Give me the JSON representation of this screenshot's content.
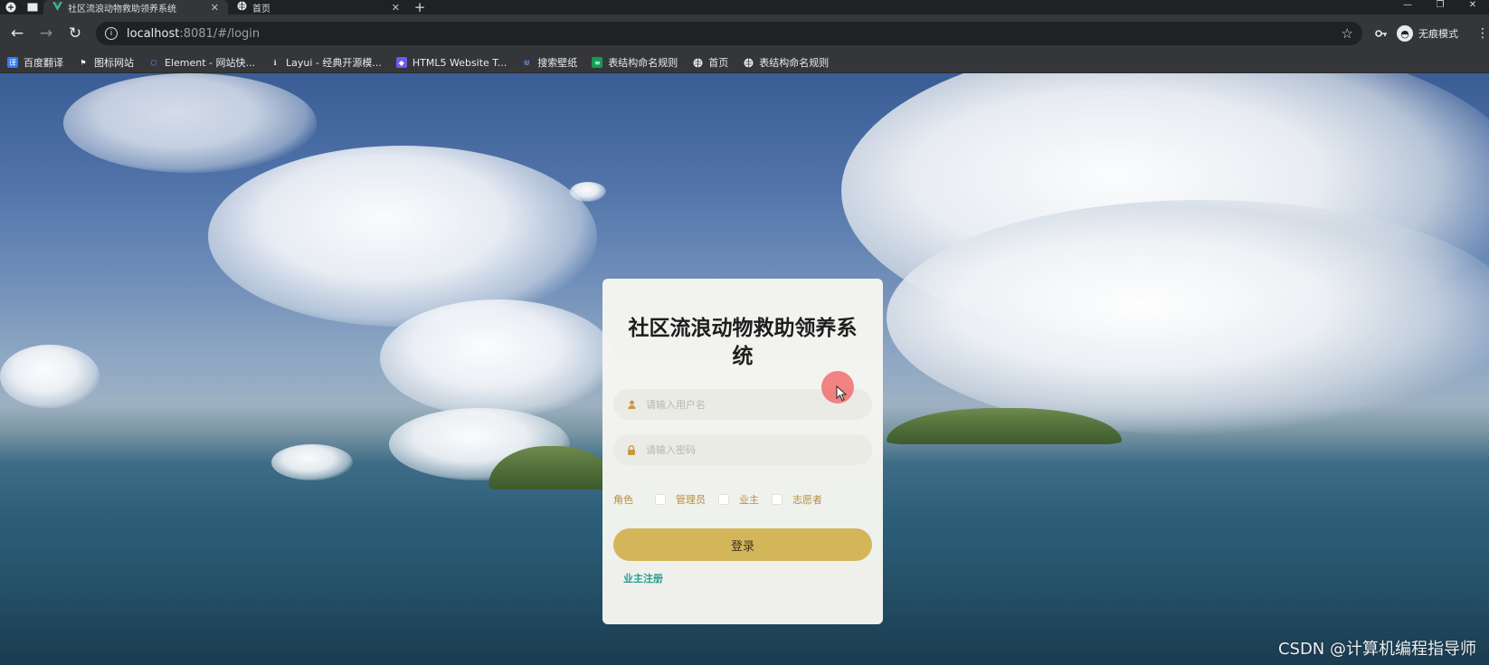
{
  "browser": {
    "tabs": [
      {
        "title": "社区流浪动物救助领养系统",
        "active": true
      },
      {
        "title": "首页",
        "active": false
      }
    ],
    "url_host": "localhost",
    "url_rest": ":8081/#/login",
    "incognito_label": "无痕模式",
    "bookmarks": [
      {
        "label": "百度翻译",
        "icon": "translate-icon"
      },
      {
        "label": "图标网站",
        "icon": "flag-icon"
      },
      {
        "label": "Element - 网站快...",
        "icon": "element-icon"
      },
      {
        "label": "Layui - 经典开源模...",
        "icon": "layui-icon"
      },
      {
        "label": "HTML5 Website T...",
        "icon": "html5-icon"
      },
      {
        "label": "搜索壁纸",
        "icon": "wallpaper-icon"
      },
      {
        "label": "表结构命名规则",
        "icon": "doc-icon"
      },
      {
        "label": "首页",
        "icon": "globe-icon"
      },
      {
        "label": "表结构命名规则",
        "icon": "globe-icon"
      }
    ]
  },
  "login": {
    "title": "社区流浪动物救助领养系统",
    "username_placeholder": "请输入用户名",
    "password_placeholder": "请输入密码",
    "role_label": "角色",
    "roles": [
      "管理员",
      "业主",
      "志愿者"
    ],
    "submit_label": "登录",
    "register_label": "业主注册"
  },
  "watermark": "CSDN @计算机编程指导师",
  "colors": {
    "card_bg": "#f6f6f1",
    "button": "#d4b65a",
    "role_text": "#b98e3c",
    "link": "#2a9d8f"
  }
}
